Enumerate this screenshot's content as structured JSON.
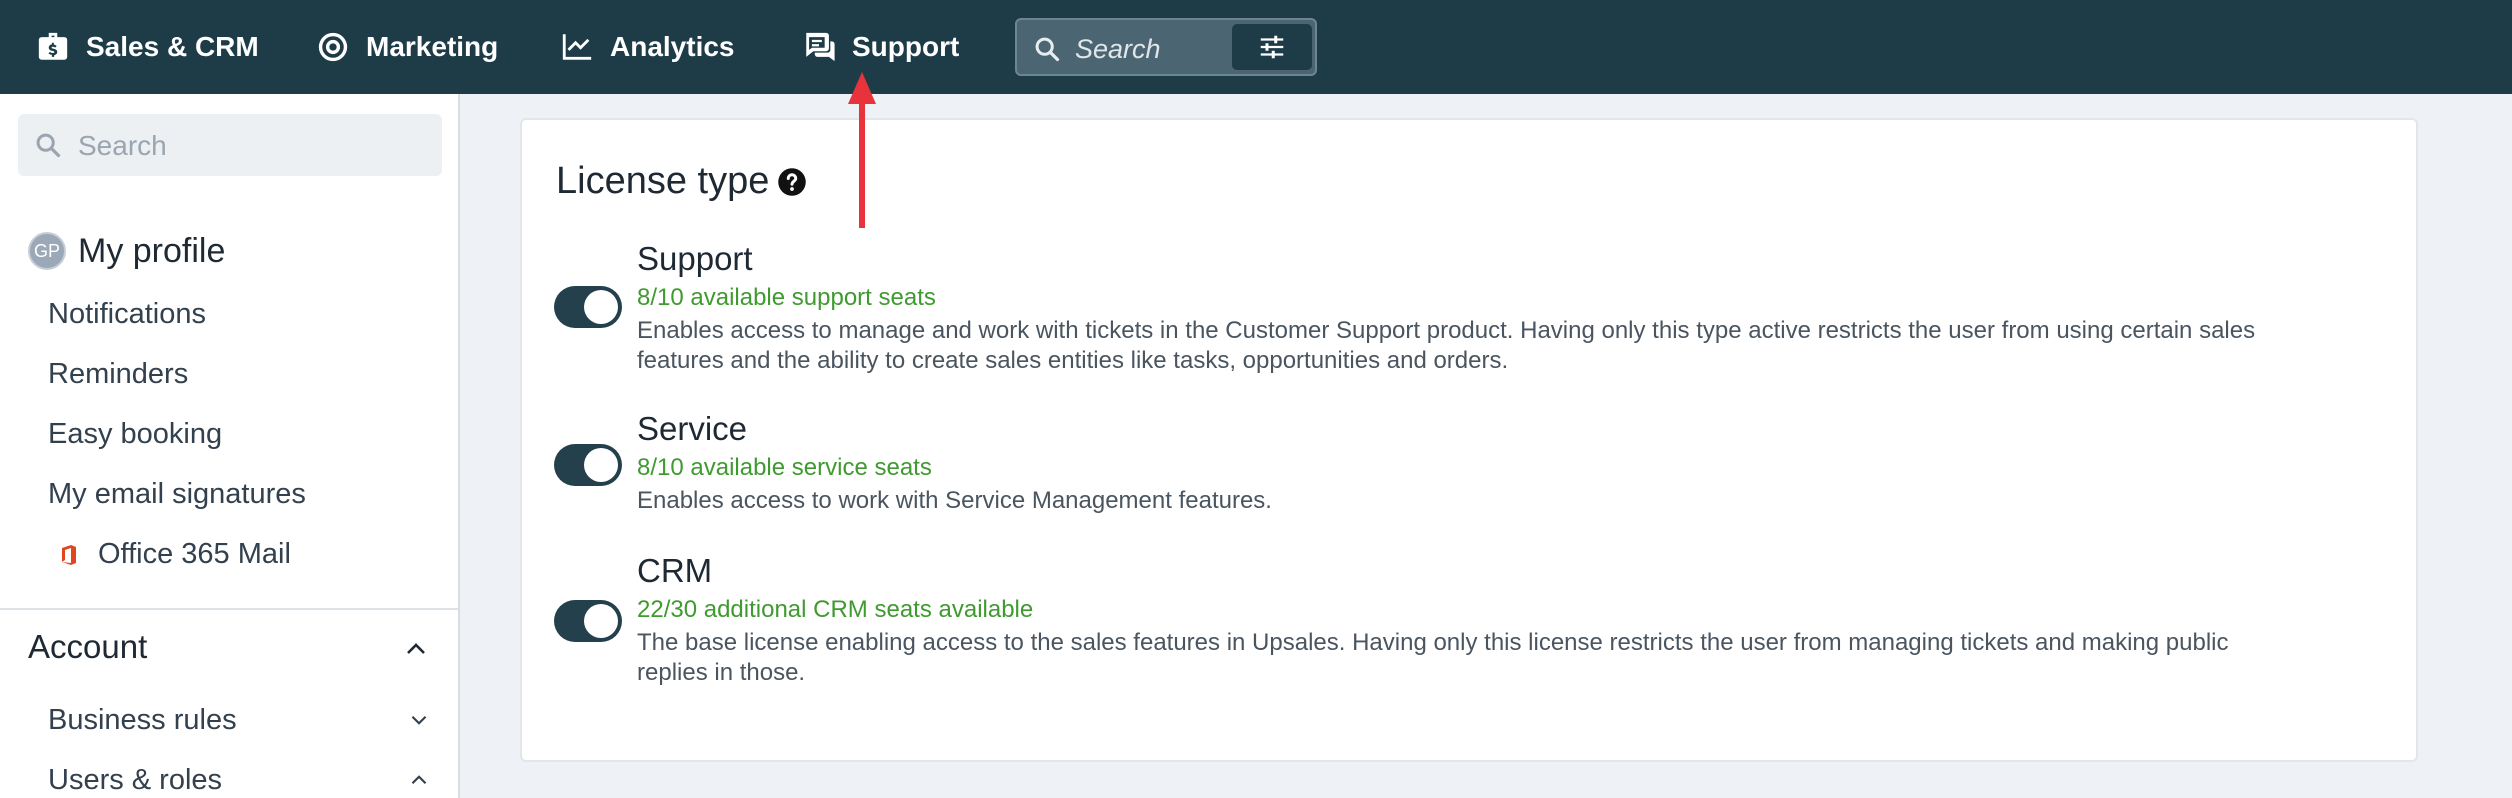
{
  "topnav": {
    "items": [
      {
        "label": "Sales & CRM",
        "icon": "briefcase-dollar-icon"
      },
      {
        "label": "Marketing",
        "icon": "target-icon"
      },
      {
        "label": "Analytics",
        "icon": "line-chart-icon"
      },
      {
        "label": "Support",
        "icon": "chat-bubbles-icon"
      }
    ],
    "search_placeholder": "Search",
    "filter_icon": "sliders-icon"
  },
  "sidebar": {
    "search_placeholder": "Search",
    "profile": {
      "initials": "GP",
      "label": "My profile"
    },
    "links": [
      "Notifications",
      "Reminders",
      "Easy booking",
      "My email signatures"
    ],
    "office_item": "Office 365 Mail",
    "section_account": "Account",
    "sub_items": [
      "Business rules",
      "Users & roles"
    ]
  },
  "card": {
    "title": "License type",
    "licenses": [
      {
        "name": "Support",
        "seats": "8/10 available support seats",
        "desc": "Enables access to manage and work with tickets in the Customer Support product. Having only this type active restricts the user from using certain sales features and the ability to create sales entities like tasks, opportunities and orders.",
        "enabled": true
      },
      {
        "name": "Service",
        "seats": "8/10 available service seats",
        "desc": "Enables access to work with Service Management features.",
        "enabled": true
      },
      {
        "name": "CRM",
        "seats": "22/30 additional CRM seats available",
        "desc": "The base license enabling access to the sales features in Upsales. Having only this license restricts the user from managing tickets and making public replies in those.",
        "enabled": true
      }
    ]
  },
  "colors": {
    "nav_bg": "#1e3c48",
    "toggle_on": "#24404c",
    "seats_green": "#3f9a2f",
    "arrow_red": "#e8323c"
  }
}
